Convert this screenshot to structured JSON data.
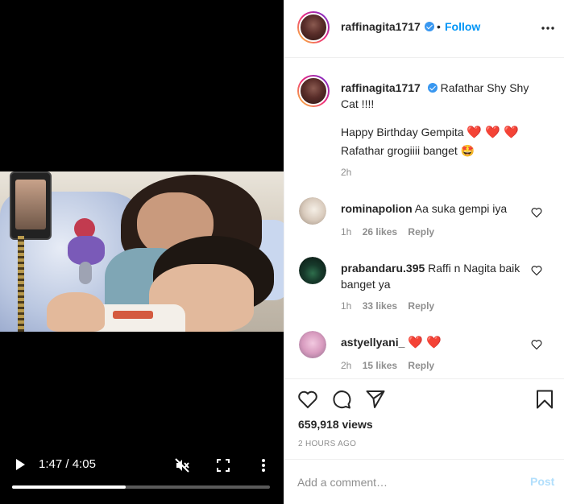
{
  "video": {
    "time_current": "1:47",
    "time_total": "4:05",
    "time_separator": "/",
    "progress": 0.44,
    "icons": {
      "play": "play-icon",
      "mute": "muted-speaker-icon",
      "fullscreen": "fullscreen-icon",
      "more": "vertical-ellipsis-icon"
    }
  },
  "header": {
    "username": "raffinagita1717",
    "verified": true,
    "separator": "•",
    "follow_label": "Follow",
    "more_icon": "horizontal-ellipsis-icon"
  },
  "caption": {
    "username": "raffinagita1717",
    "text_line1": "Rafathar Shy Shy Cat !!!!",
    "text_line2": "Happy Birthday Gempita",
    "hearts": "❤️ ❤️ ❤️",
    "text_line3": "Rafathar grogiiii banget",
    "emoji_end": "🤩",
    "time": "2h"
  },
  "comments": [
    {
      "username": "rominapolion",
      "text": "Aa suka gempi iya",
      "time": "1h",
      "likes": "26 likes",
      "reply": "Reply"
    },
    {
      "username": "prabandaru.395",
      "text": "Raffi n Nagita baik banget ya",
      "time": "1h",
      "likes": "33 likes",
      "reply": "Reply"
    },
    {
      "username": "astyellyani_",
      "text": "❤️ ❤️",
      "time": "2h",
      "likes": "15 likes",
      "reply": "Reply"
    }
  ],
  "actions": {
    "icons": [
      "heart-icon",
      "comment-icon",
      "share-icon",
      "bookmark-icon"
    ],
    "views": "659,918 views",
    "time_ago": "2 HOURS AGO"
  },
  "add_comment": {
    "placeholder": "Add a comment…",
    "post_label": "Post"
  },
  "colors": {
    "follow": "#0095f6",
    "post_disabled": "#b2dffc",
    "verified": "#3897f0",
    "heart": "#e0245e"
  }
}
